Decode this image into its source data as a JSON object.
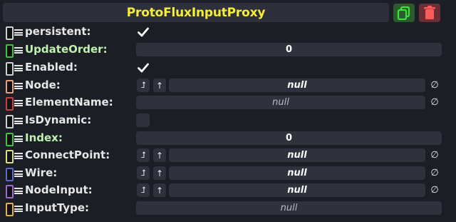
{
  "header": {
    "title": "ProtoFluxInputProxy"
  },
  "colors": {
    "title": "#f5ee3a",
    "green_label": "#bff0b0",
    "dup_btn": "#2d5a2d",
    "del_btn": "#6b2e34"
  },
  "fields": [
    {
      "label": "persistent:",
      "type": "checkbox",
      "checked": true,
      "label_color": "#e6e6e6",
      "conn_color": "#cfcfcf"
    },
    {
      "label": "UpdateOrder:",
      "type": "value",
      "value": "0",
      "label_color": "#bff0b0",
      "conn_color": "#3cc43c"
    },
    {
      "label": "Enabled:",
      "type": "checkbox",
      "checked": true,
      "label_color": "#e6e6e6",
      "conn_color": "#cfcfcf"
    },
    {
      "label": "Node:",
      "type": "ref",
      "value": "null",
      "label_color": "#e6e6e6",
      "conn_color": "#e8a07a"
    },
    {
      "label": "ElementName:",
      "type": "text",
      "value": "null",
      "label_color": "#e6e6e6",
      "conn_color": "#c84040"
    },
    {
      "label": "IsDynamic:",
      "type": "checkbox",
      "checked": false,
      "label_color": "#e6e6e6",
      "conn_color": "#cfcfcf"
    },
    {
      "label": "Index:",
      "type": "value",
      "value": "0",
      "label_color": "#bff0b0",
      "conn_color": "#3cc43c"
    },
    {
      "label": "ConnectPoint:",
      "type": "ref",
      "value": "null",
      "label_color": "#e6e6e6",
      "conn_color": "#d8e07a"
    },
    {
      "label": "Wire:",
      "type": "ref",
      "value": "null",
      "label_color": "#e6e6e6",
      "conn_color": "#5a6ad0"
    },
    {
      "label": "NodeInput:",
      "type": "ref",
      "value": "null",
      "label_color": "#e6e6e6",
      "conn_color": "#a06ad0"
    },
    {
      "label": "InputType:",
      "type": "text",
      "value": "null",
      "label_color": "#e6e6e6",
      "conn_color": "#e0b040"
    }
  ],
  "icons": {
    "duplicate": "duplicate-icon",
    "delete": "trash-icon",
    "drag": "hamburger-icon",
    "jump": "jump-to-ref-icon",
    "up": "arrow-up-icon",
    "clear": "null-clear-icon",
    "check": "checkmark-icon"
  },
  "glyphs": {
    "jump": "⮥",
    "up": "↑",
    "clear": "∅"
  }
}
